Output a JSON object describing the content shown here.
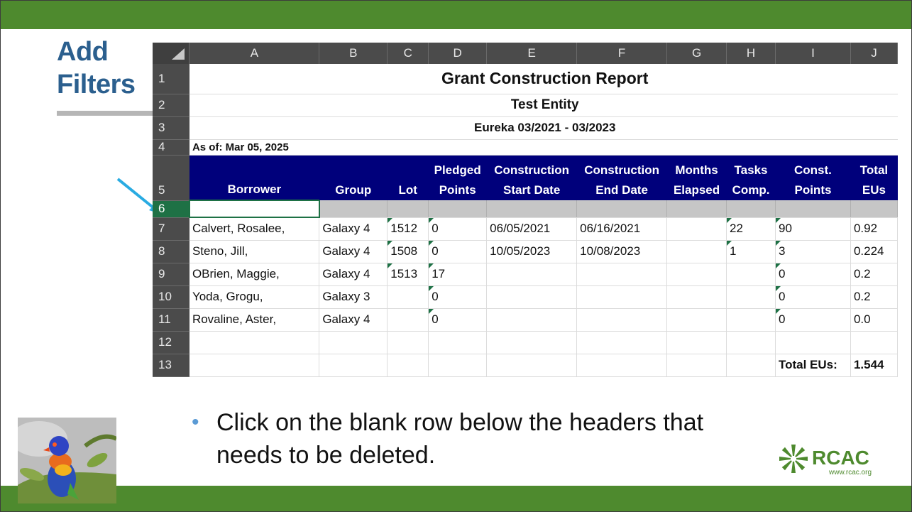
{
  "slide": {
    "title_line1": "Add",
    "title_line2": "Filters",
    "bullet": "Click on the blank row below the headers that needs to be deleted.",
    "bullet_line1": "Click on the blank row below the headers that",
    "bullet_line2": "needs to be deleted.",
    "logo_name": "RCAC",
    "logo_url": "www.rcac.org"
  },
  "sheet": {
    "columns": [
      "A",
      "B",
      "C",
      "D",
      "E",
      "F",
      "G",
      "H",
      "I",
      "J"
    ],
    "row_numbers": [
      "1",
      "2",
      "3",
      "4",
      "5",
      "6",
      "7",
      "8",
      "9",
      "10",
      "11",
      "12",
      "13"
    ],
    "title": "Grant Construction Report",
    "entity": "Test Entity",
    "period": "Eureka 03/2021 - 03/2023",
    "as_of": "As of: Mar 05, 2025",
    "headers": [
      [
        "",
        "Borrower"
      ],
      [
        "",
        "Group"
      ],
      [
        "",
        "Lot"
      ],
      [
        "Pledged",
        "Points"
      ],
      [
        "Construction",
        "Start Date"
      ],
      [
        "Construction",
        "End Date"
      ],
      [
        "Months",
        "Elapsed"
      ],
      [
        "Tasks",
        "Comp."
      ],
      [
        "Const.",
        "Points"
      ],
      [
        "Total",
        "EUs"
      ]
    ],
    "rows": [
      [
        "Calvert, Rosalee,",
        "Galaxy 4",
        "1512",
        "0",
        "06/05/2021",
        "06/16/2021",
        "",
        "22",
        "90",
        "0.92"
      ],
      [
        "Steno, Jill,",
        "Galaxy 4",
        "1508",
        "0",
        "10/05/2023",
        "10/08/2023",
        "",
        "1",
        "3",
        "0.224"
      ],
      [
        "OBrien, Maggie,",
        "Galaxy 4",
        "1513",
        "17",
        "",
        "",
        "",
        "",
        "0",
        "0.2"
      ],
      [
        "Yoda, Grogu,",
        "Galaxy 3",
        "",
        "0",
        "",
        "",
        "",
        "",
        "0",
        "0.2"
      ],
      [
        "Rovaline, Aster,",
        "Galaxy 4",
        "",
        "0",
        "",
        "",
        "",
        "",
        "0",
        "0.0"
      ]
    ],
    "total_label": "Total EUs:",
    "total_value": "1.544"
  },
  "colors": {
    "accent_green": "#4e8a2e",
    "header_navy": "#00007b",
    "title_blue": "#2b5f8e",
    "arrow": "#29abe2"
  },
  "icons": [
    "arrow-pointer-icon",
    "rcac-logo-icon",
    "bird-photo"
  ]
}
